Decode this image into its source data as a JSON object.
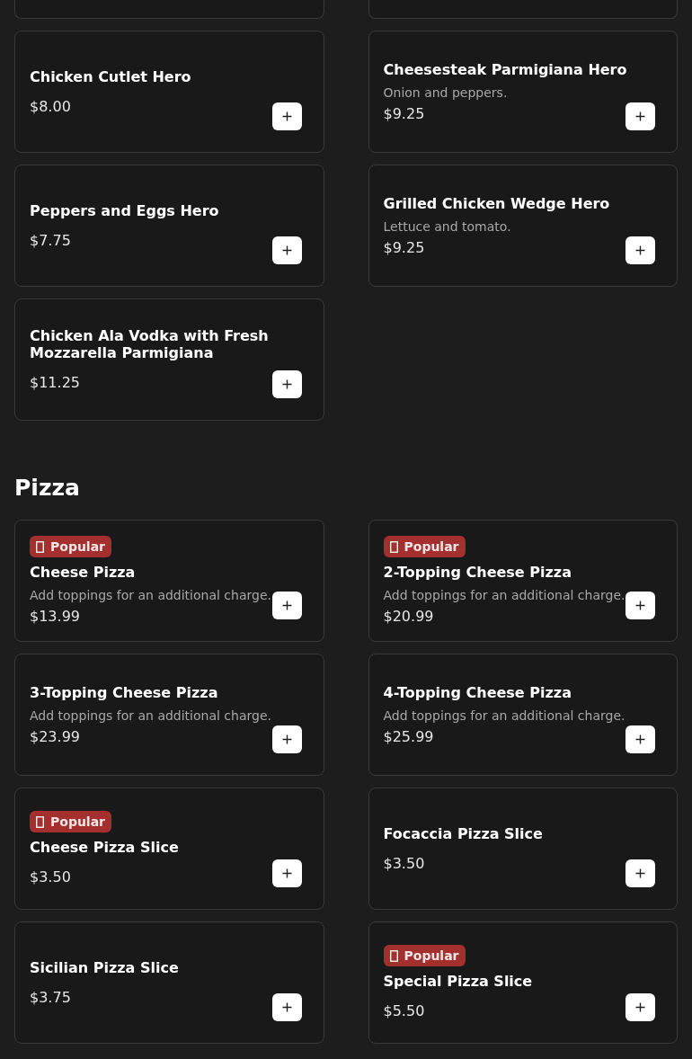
{
  "sections": [
    {
      "rows": [
        {
          "items": [
            {
              "name": "Chicken Cutlet Hero",
              "price": "$8.00"
            },
            {
              "name": "Cheesesteak Parmigiana Hero",
              "description": "Onion and peppers.",
              "price": "$9.25"
            }
          ]
        },
        {
          "items": [
            {
              "name": "Peppers and Eggs Hero",
              "price": "$7.75"
            },
            {
              "name": "Grilled Chicken Wedge Hero",
              "description": "Lettuce and tomato.",
              "price": "$9.25"
            }
          ]
        },
        {
          "items": [
            {
              "name": "Chicken Ala Vodka with Fresh Mozzarella Parmigiana",
              "price": "$11.25"
            }
          ]
        }
      ]
    },
    {
      "title": "Pizza",
      "rows": [
        {
          "items": [
            {
              "badge": "Popular",
              "name": "Cheese Pizza",
              "description": "Add toppings for an additional charge.",
              "price": "$13.99"
            },
            {
              "badge": "Popular",
              "name": "2-Topping Cheese Pizza",
              "description": "Add toppings for an additional charge.",
              "price": "$20.99"
            }
          ]
        },
        {
          "items": [
            {
              "name": "3-Topping Cheese Pizza",
              "description": "Add toppings for an additional charge.",
              "price": "$23.99"
            },
            {
              "name": "4-Topping Cheese Pizza",
              "description": "Add toppings for an additional charge.",
              "price": "$25.99"
            }
          ]
        },
        {
          "items": [
            {
              "badge": "Popular",
              "name": "Cheese Pizza Slice",
              "price": "$3.50"
            },
            {
              "name": "Focaccia Pizza Slice",
              "price": "$3.50"
            }
          ]
        },
        {
          "items": [
            {
              "name": "Sicilian Pizza Slice",
              "price": "$3.75"
            },
            {
              "badge": "Popular",
              "name": "Special Pizza Slice",
              "price": "$5.50"
            }
          ]
        }
      ]
    }
  ]
}
